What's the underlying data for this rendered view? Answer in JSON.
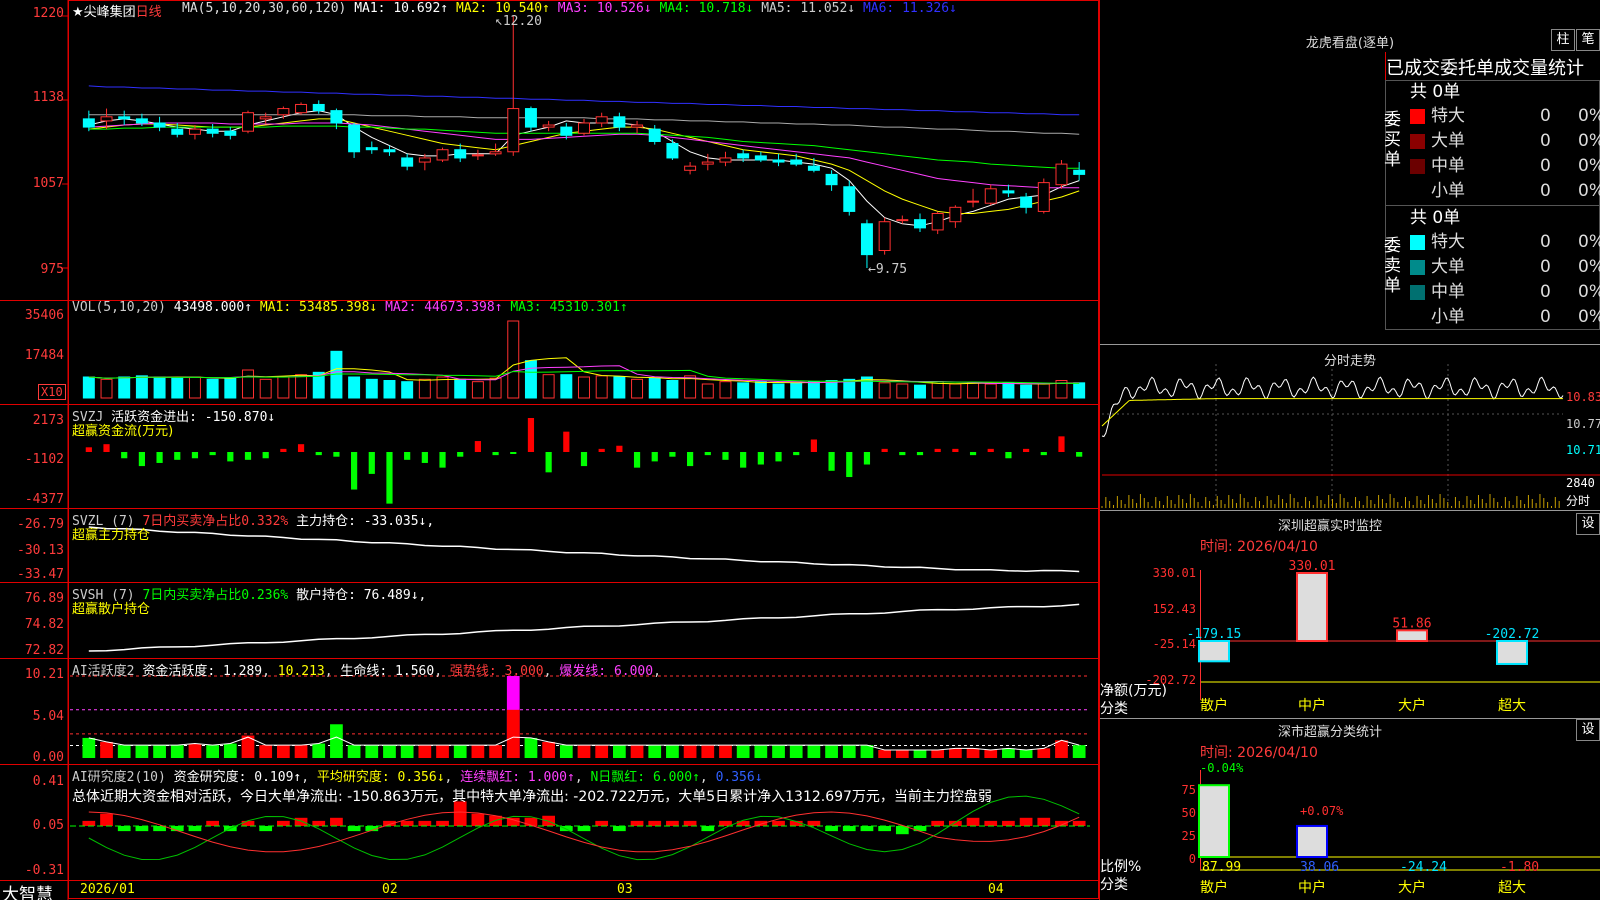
{
  "header": {
    "star": "★",
    "stock_name": "尖峰集团",
    "period": "日线",
    "ma_prefix": "MA(5,10,20,30,60,120)",
    "ma1": "MA1: 10.692↑",
    "ma2": "MA2: 10.540↑",
    "ma3": "MA3: 10.526↓",
    "ma4": "MA4: 10.718↓",
    "ma5": "MA5: 11.052↓",
    "ma6": "MA6: 11.326↓",
    "high_mark": "12.20",
    "low_mark": "9.75"
  },
  "price_axis": [
    "1220",
    "1138",
    "1057",
    "975"
  ],
  "vol_panel": {
    "title": "VOL(5,10,20)",
    "value": "43498.000↑",
    "ma1": "MA1: 53485.398↓",
    "ma2": "MA2: 44673.398↑",
    "ma3": "MA3: 45310.301↑",
    "axis": [
      "35406",
      "17484"
    ],
    "unit": "X10"
  },
  "svzj_panel": {
    "title": "SVZJ",
    "label": "活跃资金进出: -150.870↓",
    "sub": "超赢资金流(万元)",
    "axis": [
      "2173",
      "-1102",
      "-4377"
    ]
  },
  "svzl_panel": {
    "title": "SVZL (7)",
    "label_a": "7日内买卖净占比0.332%",
    "label_b": "主力持仓: -33.035↓,",
    "sub": "超赢主力持仓",
    "axis": [
      "-26.79",
      "-30.13",
      "-33.47"
    ]
  },
  "svsh_panel": {
    "title": "SVSH (7)",
    "label_a": "7日内买卖净占比0.236%",
    "label_b": "散户持仓: 76.489↓,",
    "sub": "超赢散户持仓",
    "axis": [
      "76.89",
      "74.82",
      "72.82"
    ]
  },
  "ai_panel": {
    "title": "AI活跃度2",
    "a": "资金活跃度: 1.289",
    "b": "10.213",
    "c": "生命线: 1.560",
    "d": "强势线: 3.000",
    "e": "爆发线: 6.000",
    "axis": [
      "10.21",
      "5.04",
      "0.00"
    ]
  },
  "research_panel": {
    "title": "AI研究度2(10)",
    "a": "资金研究度: 0.109↑",
    "b": "平均研究度: 0.356↓",
    "c": "连续飘红: 1.000↑",
    "d": "N日飘红: 6.000↑",
    "e": "0.356↓",
    "summary": "总体近期大资金相对活跃，今日大单净流出: -150.863万元，其中特大单净流出: -202.722万元，大单5日累计净入1312.697万元，当前主力控盘弱",
    "axis": [
      "0.41",
      "0.05",
      "-0.31"
    ]
  },
  "date_axis": {
    "brand": "大智慧",
    "labels": [
      "2026/01",
      "02",
      "03",
      "04"
    ]
  },
  "longhu": {
    "title": "龙虎看盘(逐单)",
    "btn1": "柱",
    "btn2": "笔",
    "subtitle": "已成交委托单成交量统计",
    "buy_label": "委买单",
    "sell_label": "委卖单",
    "buy_total": "共 0单",
    "sell_total": "共 0单",
    "buy_rows": [
      {
        "name": "特大",
        "count": "0",
        "pct": "0%",
        "color": "#ff0000"
      },
      {
        "name": "大单",
        "count": "0",
        "pct": "0%",
        "color": "#8b0000"
      },
      {
        "name": "中单",
        "count": "0",
        "pct": "0%",
        "color": "#6b0000"
      },
      {
        "name": "小单",
        "count": "0",
        "pct": "0%",
        "color": "#000000"
      }
    ],
    "sell_rows": [
      {
        "name": "特大",
        "count": "0",
        "pct": "0%",
        "color": "#00ffff"
      },
      {
        "name": "大单",
        "count": "0",
        "pct": "0%",
        "color": "#008b8b"
      },
      {
        "name": "中单",
        "count": "0",
        "pct": "0%",
        "color": "#007070"
      },
      {
        "name": "小单",
        "count": "0",
        "pct": "0%",
        "color": "#000000"
      }
    ]
  },
  "fenshi": {
    "title": "分时走势",
    "axis": [
      "10.83",
      "10.77",
      "10.71"
    ],
    "vol": "2840",
    "unit": "分时"
  },
  "monitor": {
    "title": "深圳超赢实时监控",
    "btn": "设",
    "time": "时间: 2026/04/10",
    "axis": [
      "330.01",
      "152.43",
      "-25.14",
      "-202.72"
    ],
    "ylabel": "净额(万元)",
    "xlabel": "分类",
    "categories": [
      "散户",
      "中户",
      "大户",
      "超大"
    ],
    "values": [
      "-179.15",
      "330.01",
      "51.86",
      "-202.72"
    ]
  },
  "classify": {
    "title": "深市超赢分类统计",
    "btn": "设",
    "time": "时间: 2026/04/10",
    "axis": [
      "75",
      "50",
      "25",
      "0"
    ],
    "ylabel": "比例%",
    "xlabel": "分类",
    "categories": [
      "散户",
      "中户",
      "大户",
      "超大"
    ],
    "values": [
      "87.99",
      "38.06",
      "-24.24",
      "-1.80"
    ],
    "top_labels": [
      "-0.04%",
      "+0.07%"
    ]
  },
  "chart_data": {
    "type": "candlestick",
    "price_ylim": [
      9.75,
      12.2
    ],
    "candles": [
      [
        11.2,
        11.28,
        11.08,
        11.12
      ],
      [
        11.18,
        11.3,
        11.1,
        11.22
      ],
      [
        11.22,
        11.28,
        11.14,
        11.2
      ],
      [
        11.2,
        11.25,
        11.13,
        11.16
      ],
      [
        11.16,
        11.22,
        11.08,
        11.12
      ],
      [
        11.1,
        11.16,
        11.02,
        11.05
      ],
      [
        11.05,
        11.14,
        11.0,
        11.1
      ],
      [
        11.1,
        11.15,
        11.02,
        11.06
      ],
      [
        11.08,
        11.12,
        11.0,
        11.04
      ],
      [
        11.08,
        11.28,
        11.06,
        11.26
      ],
      [
        11.2,
        11.26,
        11.15,
        11.22
      ],
      [
        11.24,
        11.32,
        11.2,
        11.3
      ],
      [
        11.26,
        11.36,
        11.24,
        11.34
      ],
      [
        11.34,
        11.38,
        11.25,
        11.28
      ],
      [
        11.28,
        11.3,
        11.1,
        11.16
      ],
      [
        11.14,
        11.16,
        10.82,
        10.88
      ],
      [
        10.92,
        10.98,
        10.86,
        10.9
      ],
      [
        10.9,
        10.94,
        10.84,
        10.88
      ],
      [
        10.82,
        10.86,
        10.7,
        10.74
      ],
      [
        10.78,
        10.86,
        10.7,
        10.82
      ],
      [
        10.8,
        10.92,
        10.78,
        10.9
      ],
      [
        10.9,
        10.96,
        10.78,
        10.82
      ],
      [
        10.85,
        10.9,
        10.8,
        10.85
      ],
      [
        10.86,
        10.96,
        10.84,
        10.88
      ],
      [
        10.88,
        12.2,
        10.84,
        11.3
      ],
      [
        11.3,
        11.32,
        11.08,
        11.12
      ],
      [
        11.12,
        11.18,
        11.08,
        11.14
      ],
      [
        11.12,
        11.16,
        11.0,
        11.04
      ],
      [
        11.06,
        11.2,
        11.04,
        11.16
      ],
      [
        11.16,
        11.26,
        11.12,
        11.22
      ],
      [
        11.22,
        11.26,
        11.08,
        11.12
      ],
      [
        11.12,
        11.18,
        11.06,
        11.14
      ],
      [
        11.1,
        11.14,
        10.95,
        10.98
      ],
      [
        10.96,
        11.0,
        10.8,
        10.82
      ],
      [
        10.7,
        10.78,
        10.66,
        10.74
      ],
      [
        10.76,
        10.86,
        10.7,
        10.78
      ],
      [
        10.78,
        10.88,
        10.74,
        10.82
      ],
      [
        10.86,
        10.9,
        10.78,
        10.82
      ],
      [
        10.84,
        10.88,
        10.78,
        10.8
      ],
      [
        10.8,
        10.86,
        10.74,
        10.78
      ],
      [
        10.8,
        10.86,
        10.74,
        10.76
      ],
      [
        10.74,
        10.82,
        10.68,
        10.7
      ],
      [
        10.66,
        10.7,
        10.5,
        10.56
      ],
      [
        10.54,
        10.6,
        10.26,
        10.3
      ],
      [
        10.18,
        10.22,
        9.75,
        9.88
      ],
      [
        9.92,
        10.24,
        9.88,
        10.2
      ],
      [
        10.22,
        10.26,
        10.18,
        10.22
      ],
      [
        10.22,
        10.28,
        10.1,
        10.14
      ],
      [
        10.12,
        10.3,
        10.08,
        10.28
      ],
      [
        10.2,
        10.36,
        10.14,
        10.34
      ],
      [
        10.4,
        10.52,
        10.34,
        10.4
      ],
      [
        10.38,
        10.56,
        10.36,
        10.52
      ],
      [
        10.5,
        10.56,
        10.44,
        10.48
      ],
      [
        10.44,
        10.48,
        10.28,
        10.34
      ],
      [
        10.3,
        10.62,
        10.28,
        10.58
      ],
      [
        10.56,
        10.8,
        10.52,
        10.76
      ],
      [
        10.7,
        10.78,
        10.6,
        10.66
      ]
    ],
    "ma_lines": [
      {
        "name": "MA1",
        "color": "#ffffff",
        "values": [
          11.14,
          11.18,
          11.2,
          11.18,
          11.15,
          11.12,
          11.1,
          11.08,
          11.08,
          11.14,
          11.18,
          11.22,
          11.26,
          11.28,
          11.24,
          11.12,
          11.02,
          10.94,
          10.86,
          10.84,
          10.84,
          10.86,
          10.86,
          10.86,
          11.04,
          11.08,
          11.12,
          11.18,
          11.16,
          11.16,
          11.16,
          11.14,
          11.08,
          10.98,
          10.88,
          10.82,
          10.8,
          10.8,
          10.8,
          10.8,
          10.78,
          10.76,
          10.72,
          10.6,
          10.4,
          10.24,
          10.18,
          10.16,
          10.2,
          10.26,
          10.3,
          10.36,
          10.42,
          10.44,
          10.46,
          10.54,
          10.6
        ]
      },
      {
        "name": "MA2",
        "color": "#ffff00",
        "values": [
          11.1,
          11.12,
          11.14,
          11.15,
          11.15,
          11.14,
          11.13,
          11.12,
          11.12,
          11.12,
          11.14,
          11.16,
          11.18,
          11.2,
          11.2,
          11.16,
          11.12,
          11.08,
          11.04,
          11.0,
          10.96,
          10.94,
          10.92,
          10.9,
          10.94,
          10.98,
          11.02,
          11.06,
          11.08,
          11.1,
          11.12,
          11.12,
          11.1,
          11.06,
          11.02,
          10.98,
          10.94,
          10.9,
          10.88,
          10.86,
          10.84,
          10.8,
          10.76,
          10.7,
          10.6,
          10.5,
          10.42,
          10.36,
          10.3,
          10.28,
          10.28,
          10.3,
          10.32,
          10.36,
          10.4,
          10.44,
          10.5
        ]
      },
      {
        "name": "MA3",
        "color": "#ff40ff",
        "values": [
          11.12,
          11.13,
          11.14,
          11.15,
          11.16,
          11.16,
          11.16,
          11.16,
          11.15,
          11.15,
          11.15,
          11.15,
          11.16,
          11.16,
          11.16,
          11.15,
          11.14,
          11.12,
          11.1,
          11.08,
          11.06,
          11.04,
          11.02,
          11.0,
          11.0,
          11.0,
          11.01,
          11.02,
          11.03,
          11.04,
          11.05,
          11.05,
          11.04,
          11.02,
          11.0,
          10.98,
          10.96,
          10.94,
          10.92,
          10.9,
          10.88,
          10.86,
          10.84,
          10.82,
          10.78,
          10.74,
          10.7,
          10.66,
          10.62,
          10.6,
          10.58,
          10.56,
          10.55,
          10.54,
          10.53,
          10.53,
          10.53
        ]
      },
      {
        "name": "MA4",
        "color": "#00ff00",
        "values": [
          11.1,
          11.1,
          11.11,
          11.11,
          11.12,
          11.12,
          11.12,
          11.12,
          11.12,
          11.12,
          11.12,
          11.13,
          11.13,
          11.13,
          11.13,
          11.12,
          11.12,
          11.11,
          11.1,
          11.1,
          11.09,
          11.08,
          11.07,
          11.06,
          11.06,
          11.06,
          11.06,
          11.06,
          11.06,
          11.06,
          11.06,
          11.06,
          11.05,
          11.04,
          11.03,
          11.02,
          11.0,
          10.98,
          10.97,
          10.96,
          10.95,
          10.94,
          10.92,
          10.9,
          10.88,
          10.86,
          10.84,
          10.82,
          10.8,
          10.79,
          10.78,
          10.76,
          10.75,
          10.74,
          10.73,
          10.72,
          10.72
        ]
      },
      {
        "name": "MA5",
        "color": "#aaaaaa",
        "values": [
          11.24,
          11.24,
          11.24,
          11.24,
          11.24,
          11.24,
          11.24,
          11.24,
          11.24,
          11.24,
          11.24,
          11.24,
          11.24,
          11.24,
          11.24,
          11.24,
          11.23,
          11.23,
          11.23,
          11.22,
          11.22,
          11.22,
          11.21,
          11.21,
          11.21,
          11.21,
          11.21,
          11.21,
          11.21,
          11.2,
          11.2,
          11.2,
          11.19,
          11.19,
          11.18,
          11.18,
          11.17,
          11.17,
          11.16,
          11.16,
          11.15,
          11.15,
          11.14,
          11.14,
          11.13,
          11.12,
          11.12,
          11.11,
          11.1,
          11.1,
          11.09,
          11.08,
          11.08,
          11.07,
          11.06,
          11.06,
          11.05
        ]
      },
      {
        "name": "MA6",
        "color": "#3030ff",
        "values": [
          11.52,
          11.51,
          11.51,
          11.5,
          11.5,
          11.49,
          11.49,
          11.48,
          11.48,
          11.47,
          11.47,
          11.46,
          11.46,
          11.45,
          11.45,
          11.44,
          11.44,
          11.43,
          11.43,
          11.42,
          11.42,
          11.41,
          11.41,
          11.4,
          11.4,
          11.39,
          11.39,
          11.38,
          11.38,
          11.37,
          11.37,
          11.36,
          11.36,
          11.35,
          11.35,
          11.34,
          11.34,
          11.33,
          11.33,
          11.32,
          11.32,
          11.31,
          11.31,
          11.3,
          11.3,
          11.29,
          11.29,
          11.28,
          11.28,
          11.27,
          11.27,
          11.26,
          11.26,
          11.25,
          11.25,
          11.24,
          11.24
        ]
      }
    ],
    "volume": [
      9000,
      8000,
      9000,
      9500,
      9000,
      8500,
      9000,
      8000,
      8500,
      12000,
      8000,
      9000,
      10000,
      11000,
      20000,
      9000,
      8000,
      7500,
      7000,
      8000,
      9000,
      8000,
      7000,
      8500,
      33000,
      16000,
      10000,
      10000,
      9000,
      9500,
      9000,
      8000,
      8500,
      7500,
      9500,
      6000,
      7000,
      6500,
      7000,
      6000,
      6500,
      7000,
      7500,
      8000,
      9000,
      6500,
      6000,
      5500,
      7000,
      6000,
      6500,
      6000,
      6500,
      5500,
      6000,
      7500,
      6500
    ],
    "svzj": [
      300,
      500,
      -400,
      -900,
      -700,
      -500,
      -400,
      -200,
      -600,
      -500,
      -400,
      200,
      500,
      -200,
      -300,
      -2400,
      -1400,
      -3300,
      -500,
      -700,
      -1000,
      -300,
      700,
      -200,
      -100,
      2173,
      -1300,
      1300,
      -900,
      200,
      400,
      -1000,
      -600,
      -300,
      -900,
      -200,
      -500,
      -1000,
      -800,
      -600,
      -200,
      800,
      -1200,
      -1600,
      -800,
      200,
      -200,
      -200,
      200,
      200,
      -200,
      200,
      -400,
      200,
      -200,
      1000,
      -300
    ],
    "ai_active": [
      2.5,
      2.0,
      1.6,
      1.6,
      1.6,
      1.6,
      1.8,
      1.6,
      1.8,
      2.8,
      1.6,
      1.6,
      1.6,
      1.8,
      4.2,
      1.6,
      1.6,
      1.6,
      1.6,
      1.6,
      1.6,
      1.6,
      1.6,
      1.6,
      10.21,
      2.5,
      2.0,
      1.6,
      1.6,
      1.6,
      1.6,
      1.6,
      1.6,
      1.6,
      1.6,
      1.6,
      1.6,
      1.6,
      1.6,
      1.6,
      1.6,
      1.6,
      1.6,
      1.6,
      1.6,
      1.0,
      1.0,
      1.0,
      1.0,
      1.2,
      1.2,
      1.0,
      1.2,
      1.0,
      1.2,
      2.2,
      1.6
    ],
    "research": [
      0.05,
      0.12,
      -0.05,
      -0.05,
      -0.05,
      -0.05,
      -0.05,
      0.05,
      -0.05,
      0.05,
      -0.05,
      0.05,
      0.08,
      0.05,
      0.08,
      -0.05,
      -0.05,
      0.05,
      0.05,
      0.05,
      0.05,
      0.24,
      0.12,
      0.1,
      0.08,
      0.08,
      0.1,
      -0.05,
      -0.05,
      0.05,
      -0.05,
      0.05,
      0.05,
      0.05,
      0.05,
      -0.05,
      0.05,
      0.05,
      0.05,
      0.05,
      0.05,
      0.05,
      -0.05,
      -0.05,
      -0.05,
      -0.05,
      -0.08,
      -0.05,
      0.05,
      0.05,
      0.08,
      0.05,
      0.05,
      0.08,
      0.08,
      0.05,
      0.05
    ]
  }
}
